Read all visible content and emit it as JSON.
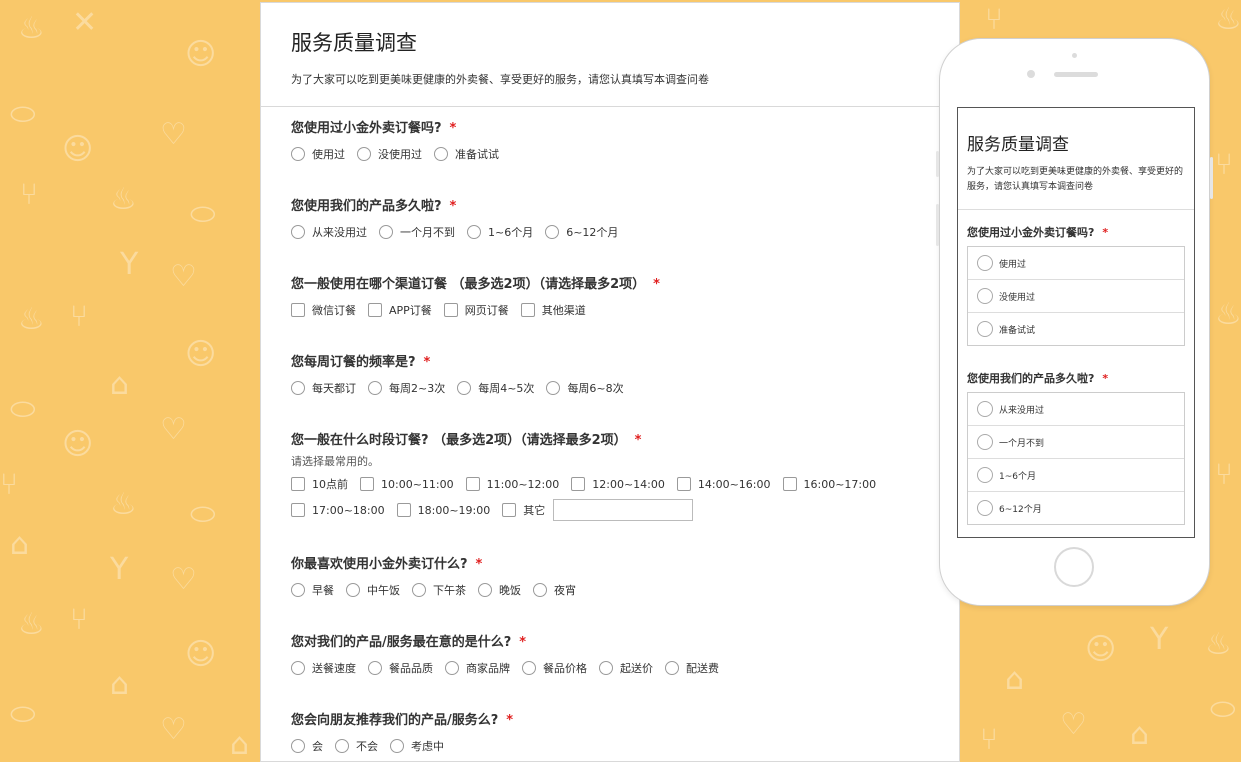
{
  "survey": {
    "title": "服务质量调查",
    "description": "为了大家可以吃到更美味更健康的外卖餐、享受更好的服务，请您认真填写本调查问卷",
    "required_mark": "*",
    "questions": [
      {
        "title": "您使用过小金外卖订餐吗?",
        "type": "radio",
        "options": [
          "使用过",
          "没使用过",
          "准备试试"
        ]
      },
      {
        "title": "您使用我们的产品多久啦?",
        "type": "radio",
        "options": [
          "从来没用过",
          "一个月不到",
          "1~6个月",
          "6~12个月"
        ]
      },
      {
        "title": "您一般使用在哪个渠道订餐 （最多选2项）（请选择最多2项）",
        "type": "checkbox",
        "options": [
          "微信订餐",
          "APP订餐",
          "网页订餐",
          "其他渠道"
        ]
      },
      {
        "title": "您每周订餐的频率是?",
        "type": "radio",
        "options": [
          "每天都订",
          "每周2~3次",
          "每周4~5次",
          "每周6~8次"
        ]
      },
      {
        "title": "您一般在什么时段订餐? （最多选2项）（请选择最多2项）",
        "type": "checkbox",
        "hint": "请选择最常用的。",
        "options": [
          "10点前",
          "10:00~11:00",
          "11:00~12:00",
          "12:00~14:00",
          "14:00~16:00",
          "16:00~17:00",
          "17:00~18:00",
          "18:00~19:00",
          "其它"
        ]
      },
      {
        "title": "你最喜欢使用小金外卖订什么?",
        "type": "radio",
        "options": [
          "早餐",
          "中午饭",
          "下午茶",
          "晚饭",
          "夜宵"
        ]
      },
      {
        "title": "您对我们的产品/服务最在意的是什么?",
        "type": "radio",
        "options": [
          "送餐速度",
          "餐品品质",
          "商家品牌",
          "餐品价格",
          "起送价",
          "配送费"
        ]
      },
      {
        "title": "您会向朋友推荐我们的产品/服务么?",
        "type": "radio",
        "options": [
          "会",
          "不会",
          "考虑中"
        ]
      }
    ]
  },
  "phone": {
    "title": "服务质量调查",
    "description": "为了大家可以吃到更美味更健康的外卖餐、享受更好的服务，请您认真填写本调查问卷",
    "questions": [
      {
        "title": "您使用过小金外卖订餐吗?",
        "options": [
          "使用过",
          "没使用过",
          "准备试试"
        ]
      },
      {
        "title": "您使用我们的产品多久啦?",
        "options": [
          "从来没用过",
          "一个月不到",
          "1~6个月",
          "6~12个月"
        ]
      }
    ]
  },
  "icons": {
    "background_pattern": [
      "fork-icon",
      "heart-icon",
      "smiley-icon",
      "ice-cream-icon",
      "burger-icon",
      "cocktail-icon",
      "chef-hat-icon"
    ]
  },
  "colors": {
    "background": "#f9c86a",
    "required": "#e02020",
    "card": "#ffffff"
  }
}
